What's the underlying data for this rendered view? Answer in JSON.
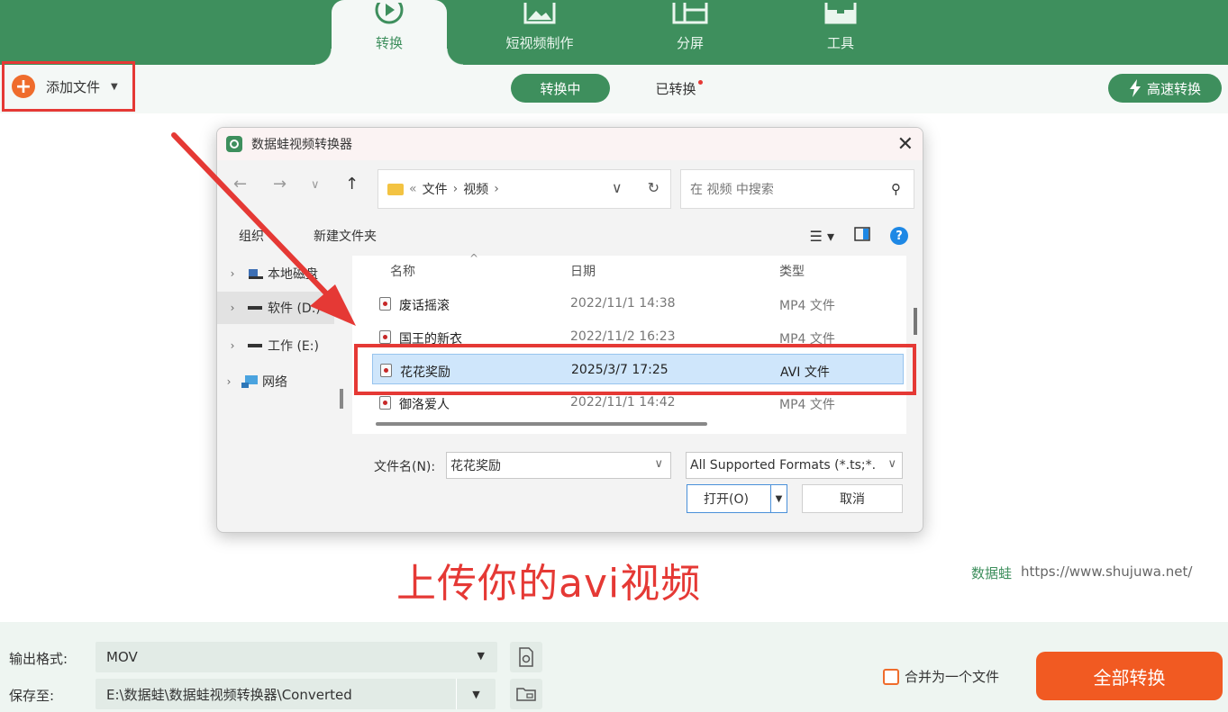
{
  "nav": {
    "tabs": [
      {
        "label": "转换",
        "icon": "convert-icon",
        "active": true
      },
      {
        "label": "短视频制作",
        "icon": "image-icon"
      },
      {
        "label": "分屏",
        "icon": "split-screen-icon"
      },
      {
        "label": "工具",
        "icon": "toolbox-icon"
      }
    ]
  },
  "toolbar": {
    "add_file": "添加文件",
    "tab_converting": "转换中",
    "tab_converted": "已转换",
    "fast_convert": "高速转换"
  },
  "dialog": {
    "title": "数据蛙视频转换器",
    "breadcrumb": [
      "文件",
      "视频"
    ],
    "search_placeholder": "在 视频 中搜索",
    "organize": "组织",
    "new_folder": "新建文件夹",
    "tree": [
      {
        "label": "本地磁盘"
      },
      {
        "label": "软件 (D:)",
        "selected": true
      },
      {
        "label": "工作 (E:)"
      },
      {
        "label": "网络"
      }
    ],
    "columns": {
      "name": "名称",
      "date": "日期",
      "type": "类型"
    },
    "files": [
      {
        "name": "废话摇滚",
        "date": "2022/11/1 14:38",
        "type": "MP4 文件"
      },
      {
        "name": "国王的新衣",
        "date": "2022/11/2 16:23",
        "type": "MP4 文件"
      },
      {
        "name": "花花奖励",
        "date": "2025/3/7 17:25",
        "type": "AVI 文件",
        "selected": true
      },
      {
        "name": "御洛爱人",
        "date": "2022/11/1 14:42",
        "type": "MP4 文件"
      }
    ],
    "filename_label": "文件名(N):",
    "filename_value": "花花奖励",
    "filter_value": "All Supported Formats (*.ts;*.",
    "open_label": "打开(O)",
    "cancel_label": "取消"
  },
  "caption": "上传你的avi视频",
  "watermark": {
    "brand": "数据蛙",
    "url": "https://www.shujuwa.net/"
  },
  "bottom": {
    "output_format_label": "输出格式:",
    "output_format_value": "MOV",
    "save_to_label": "保存至:",
    "save_to_value": "E:\\数据蛙\\数据蛙视频转换器\\Converted",
    "merge_label": "合并为一个文件",
    "convert_all": "全部转换"
  },
  "colors": {
    "brand_green": "#3e8f5d",
    "accent_orange": "#f15a22",
    "annotation_red": "#e53935"
  }
}
